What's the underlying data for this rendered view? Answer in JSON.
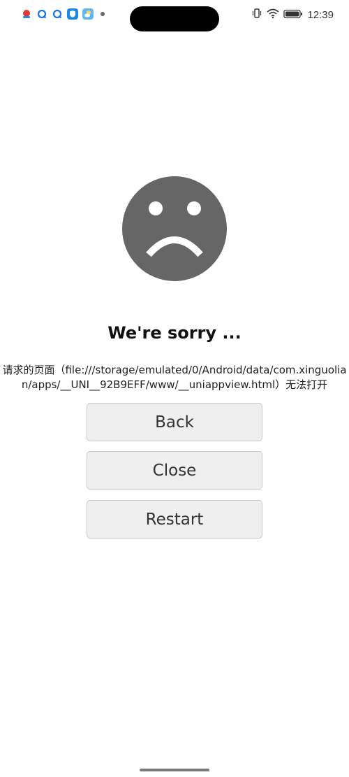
{
  "status_bar": {
    "time": "12:39",
    "notification_icons": [
      "app-bell-icon",
      "qq-icon",
      "qq-icon",
      "shield-app-icon",
      "weather-icon",
      "more-dot-icon"
    ],
    "system_icons": [
      "vibrate-icon",
      "wifi-icon",
      "battery-icon"
    ]
  },
  "error": {
    "face_icon": "sad-face-icon",
    "face_color": "#666666",
    "title": "We're sorry ...",
    "message": "请求的页面（file:///storage/emulated/0/Android/data/com.xinguolian/apps/__UNI__92B9EFF/www/__uniappview.html）无法打开"
  },
  "buttons": {
    "back": "Back",
    "close": "Close",
    "restart": "Restart"
  }
}
